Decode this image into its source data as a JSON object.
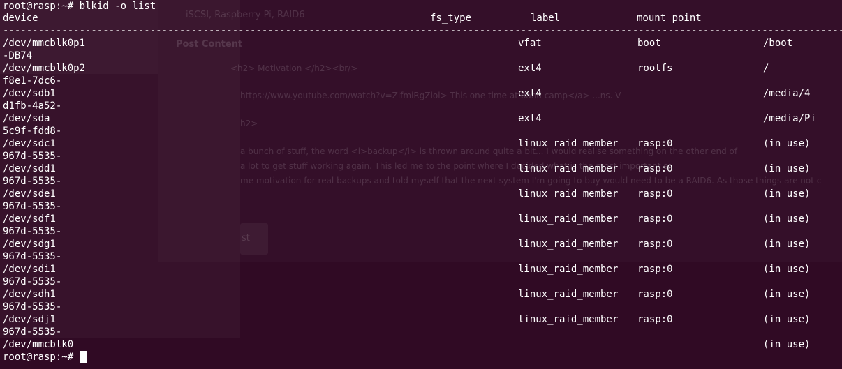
{
  "terminal": {
    "command_line": "root@rasp:~# blkid -o list",
    "prompt": "root@rasp:~# "
  },
  "table": {
    "headers": {
      "device": "device",
      "fs_type": "fs_type",
      "label": "label",
      "mount_point": "mount point"
    },
    "separator": "--------------------------------------------------------------------------------------------------------------------------------------------------------------------------------------------------------------------------------------------------------",
    "rows": [
      {
        "device": "/dev/mmcblk0p1",
        "uuid": "-DB74",
        "fs_type": "vfat",
        "label": "boot",
        "mount": "/boot"
      },
      {
        "device": "/dev/mmcblk0p2",
        "uuid": "f8e1-7dc6-",
        "fs_type": "ext4",
        "label": "rootfs",
        "mount": "/"
      },
      {
        "device": "/dev/sdb1",
        "uuid": "d1fb-4a52-",
        "fs_type": "ext4",
        "label": "",
        "mount": "/media/4"
      },
      {
        "device": "/dev/sda",
        "uuid": "5c9f-fdd8-",
        "fs_type": "ext4",
        "label": "",
        "mount": "/media/Pi"
      },
      {
        "device": "/dev/sdc1",
        "uuid": "967d-5535-",
        "fs_type": "linux_raid_member",
        "label": "rasp:0",
        "mount": "(in use)"
      },
      {
        "device": "/dev/sdd1",
        "uuid": "967d-5535-",
        "fs_type": "linux_raid_member",
        "label": "rasp:0",
        "mount": "(in use)"
      },
      {
        "device": "/dev/sde1",
        "uuid": "967d-5535-",
        "fs_type": "linux_raid_member",
        "label": "rasp:0",
        "mount": "(in use)"
      },
      {
        "device": "/dev/sdf1",
        "uuid": "967d-5535-",
        "fs_type": "linux_raid_member",
        "label": "rasp:0",
        "mount": "(in use)"
      },
      {
        "device": "/dev/sdg1",
        "uuid": "967d-5535-",
        "fs_type": "linux_raid_member",
        "label": "rasp:0",
        "mount": "(in use)"
      },
      {
        "device": "/dev/sdi1",
        "uuid": "967d-5535-",
        "fs_type": "linux_raid_member",
        "label": "rasp:0",
        "mount": "(in use)"
      },
      {
        "device": "/dev/sdh1",
        "uuid": "967d-5535-",
        "fs_type": "linux_raid_member",
        "label": "rasp:0",
        "mount": "(in use)"
      },
      {
        "device": "/dev/sdj1",
        "uuid": "967d-5535-",
        "fs_type": "linux_raid_member",
        "label": "rasp:0",
        "mount": "(in use)"
      },
      {
        "device": "/dev/mmcblk0",
        "uuid": "",
        "fs_type": "",
        "label": "",
        "mount": "(in use)"
      }
    ]
  },
  "background_window": {
    "title": "iSCSI, Raspberry Pi, RAID6",
    "section": "Post Content",
    "line1": "<h2>  Motivation </h2><br/>",
    "line2": "https://www.youtube.com/watch?v=ZifmiRgZiol> This one time at band camp</a> ...ns. V",
    "line3": "h2>",
    "line4": "a bunch of stuff, the word <i>backup</i> is thrown around quite a bit... I would realise something on the other end of",
    "line5": "a lot to get stuff working again. This led me to the point where I decided what is the most important s",
    "line6": "me motivation for real backups and told myself that the next system I'm going to buy would need to be a RAID6. As those things are not c",
    "button": "st"
  },
  "colors": {
    "background": "#300a24",
    "text": "#ffffff"
  }
}
